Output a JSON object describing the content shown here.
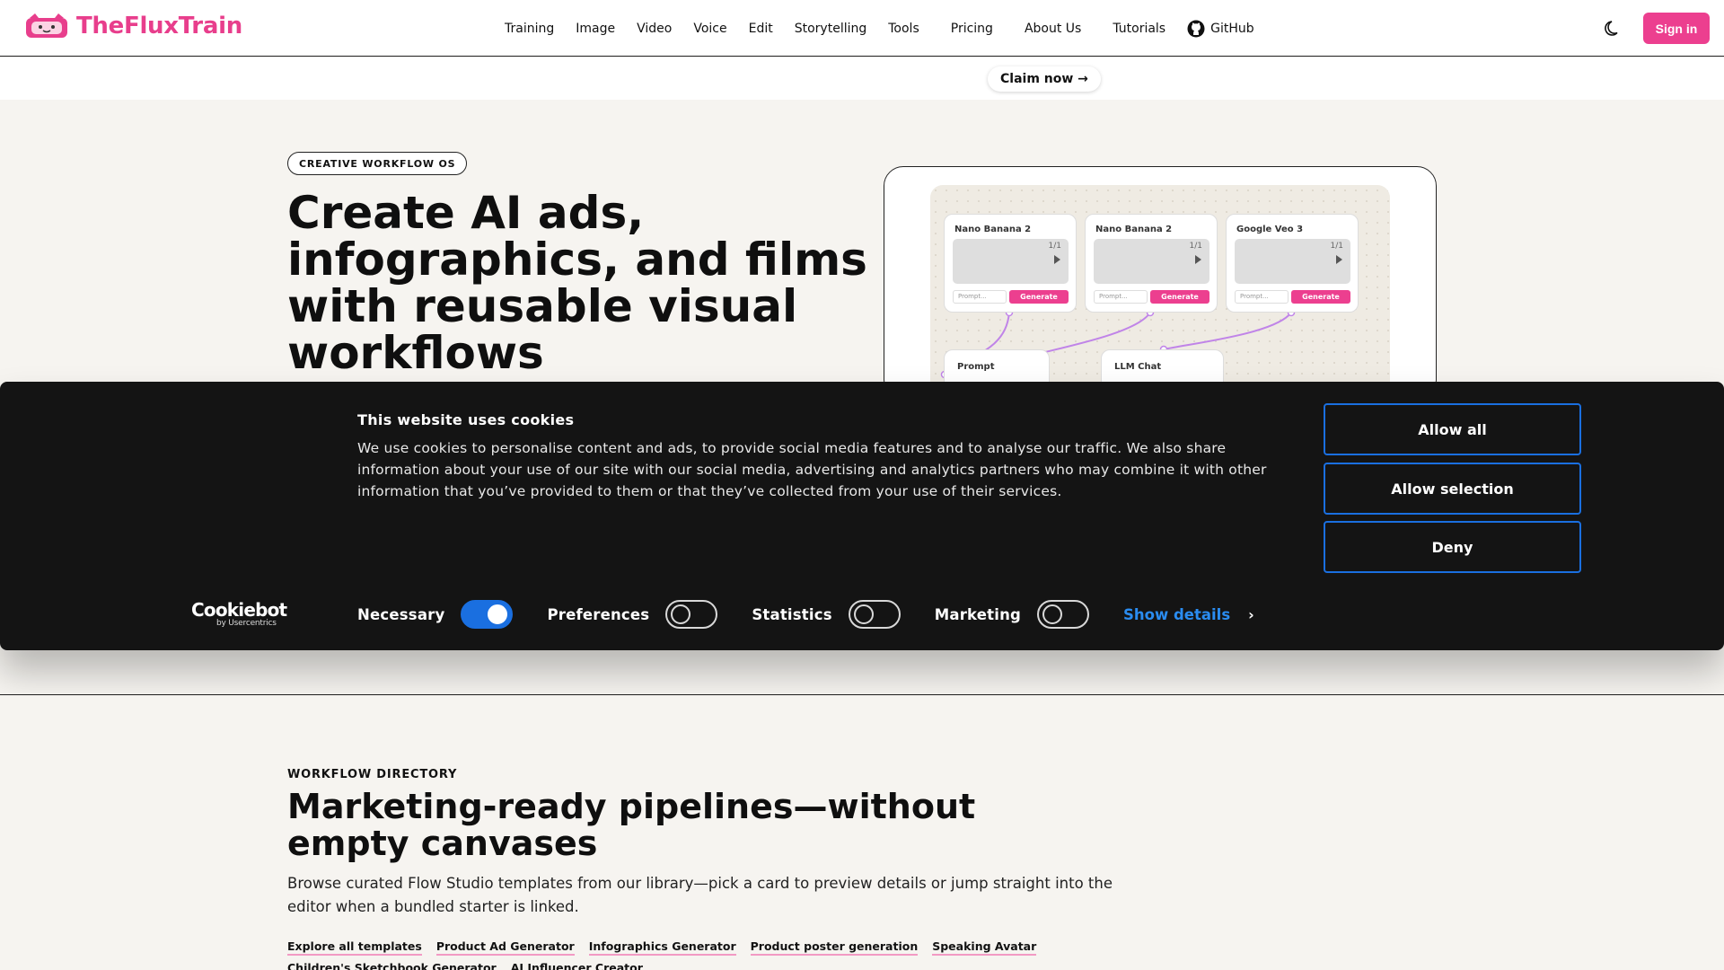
{
  "header": {
    "brand": "TheFluxTrain",
    "nav": [
      "Training",
      "Image",
      "Video",
      "Voice",
      "Edit",
      "Storytelling",
      "Tools",
      "Pricing",
      "About Us",
      "Tutorials",
      "GitHub"
    ],
    "signin_label": "Sign in",
    "brand_color": "#e83e8c"
  },
  "promo": {
    "cta": "Claim now →"
  },
  "hero": {
    "badge": "CREATIVE WORKFLOW OS",
    "title": "Create AI ads, infographics, and films with reusable visual workflows",
    "preview": {
      "nodes": [
        {
          "title": "Nano Banana 2",
          "count": "1/1",
          "prompt_placeholder": "Prompt...",
          "button": "Generate"
        },
        {
          "title": "Nano Banana 2",
          "count": "1/1",
          "prompt_placeholder": "Prompt...",
          "button": "Generate"
        },
        {
          "title": "Google Veo 3",
          "count": "1/1",
          "prompt_placeholder": "Prompt...",
          "button": "Generate"
        }
      ],
      "lower_nodes": [
        "Prompt",
        "LLM Chat"
      ]
    }
  },
  "cookie_banner": {
    "title": "This website uses cookies",
    "body": "We use cookies to personalise content and ads, to provide social media features and to analyse our traffic. We also share information about your use of our site with our social media, advertising and analytics partners who may combine it with other information that you’ve provided to them or that they’ve collected from your use of their services.",
    "buttons": {
      "allow_all": "Allow all",
      "allow_selection": "Allow selection",
      "deny": "Deny"
    },
    "brand": {
      "name": "Cookiebot",
      "sub": "by Usercentrics"
    },
    "consents": [
      {
        "label": "Necessary",
        "enabled": true
      },
      {
        "label": "Preferences",
        "enabled": false
      },
      {
        "label": "Statistics",
        "enabled": false
      },
      {
        "label": "Marketing",
        "enabled": false
      }
    ],
    "show_details": "Show details",
    "accent_color": "#1a6fe0"
  },
  "directory": {
    "kicker": "WORKFLOW DIRECTORY",
    "title": "Marketing-ready pipelines—without empty canvases",
    "description": "Browse curated Flow Studio templates from our library—pick a card to preview details or jump straight into the editor when a bundled starter is linked.",
    "links": [
      "Explore all templates",
      "Product Ad Generator",
      "Infographics Generator",
      "Product poster generation",
      "Speaking Avatar",
      "Children's Sketchbook Generator",
      "AI Influencer Creator"
    ]
  }
}
